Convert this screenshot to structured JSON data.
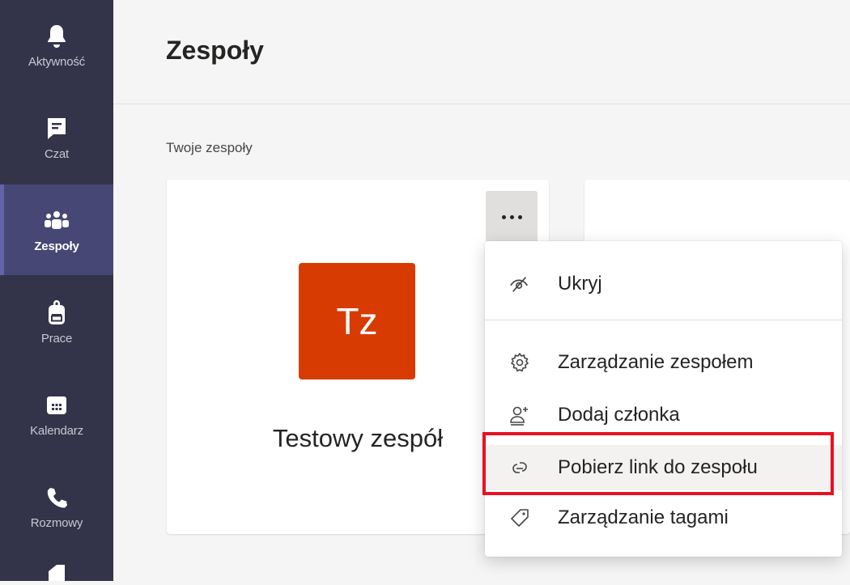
{
  "rail": {
    "items": [
      {
        "label": "Aktywność",
        "icon": "bell-icon"
      },
      {
        "label": "Czat",
        "icon": "chat-icon"
      },
      {
        "label": "Zespoły",
        "icon": "teams-icon"
      },
      {
        "label": "Prace",
        "icon": "backpack-icon"
      },
      {
        "label": "Kalendarz",
        "icon": "calendar-icon"
      },
      {
        "label": "Rozmowy",
        "icon": "phone-icon"
      }
    ],
    "active_index": 2
  },
  "header": {
    "title": "Zespoły"
  },
  "section": {
    "label": "Twoje zespoły"
  },
  "teams": [
    {
      "initials": "Tz",
      "name": "Testowy zespół",
      "color": "#d83b01"
    }
  ],
  "menu": {
    "items": [
      {
        "label": "Ukryj",
        "icon": "hide-eye-icon"
      },
      {
        "label": "Zarządzanie zespołem",
        "icon": "gear-icon"
      },
      {
        "label": "Dodaj członka",
        "icon": "add-person-icon"
      },
      {
        "label": "Pobierz link do zespołu",
        "icon": "link-icon"
      },
      {
        "label": "Zarządzanie tagami",
        "icon": "tag-icon"
      }
    ],
    "highlighted_item": "Pobierz link do zespołu"
  },
  "colors": {
    "rail_bg": "#33344a",
    "rail_active": "#464775",
    "accent": "#6264a7",
    "team_avatar": "#d83b01",
    "highlight_border": "#e81123"
  }
}
